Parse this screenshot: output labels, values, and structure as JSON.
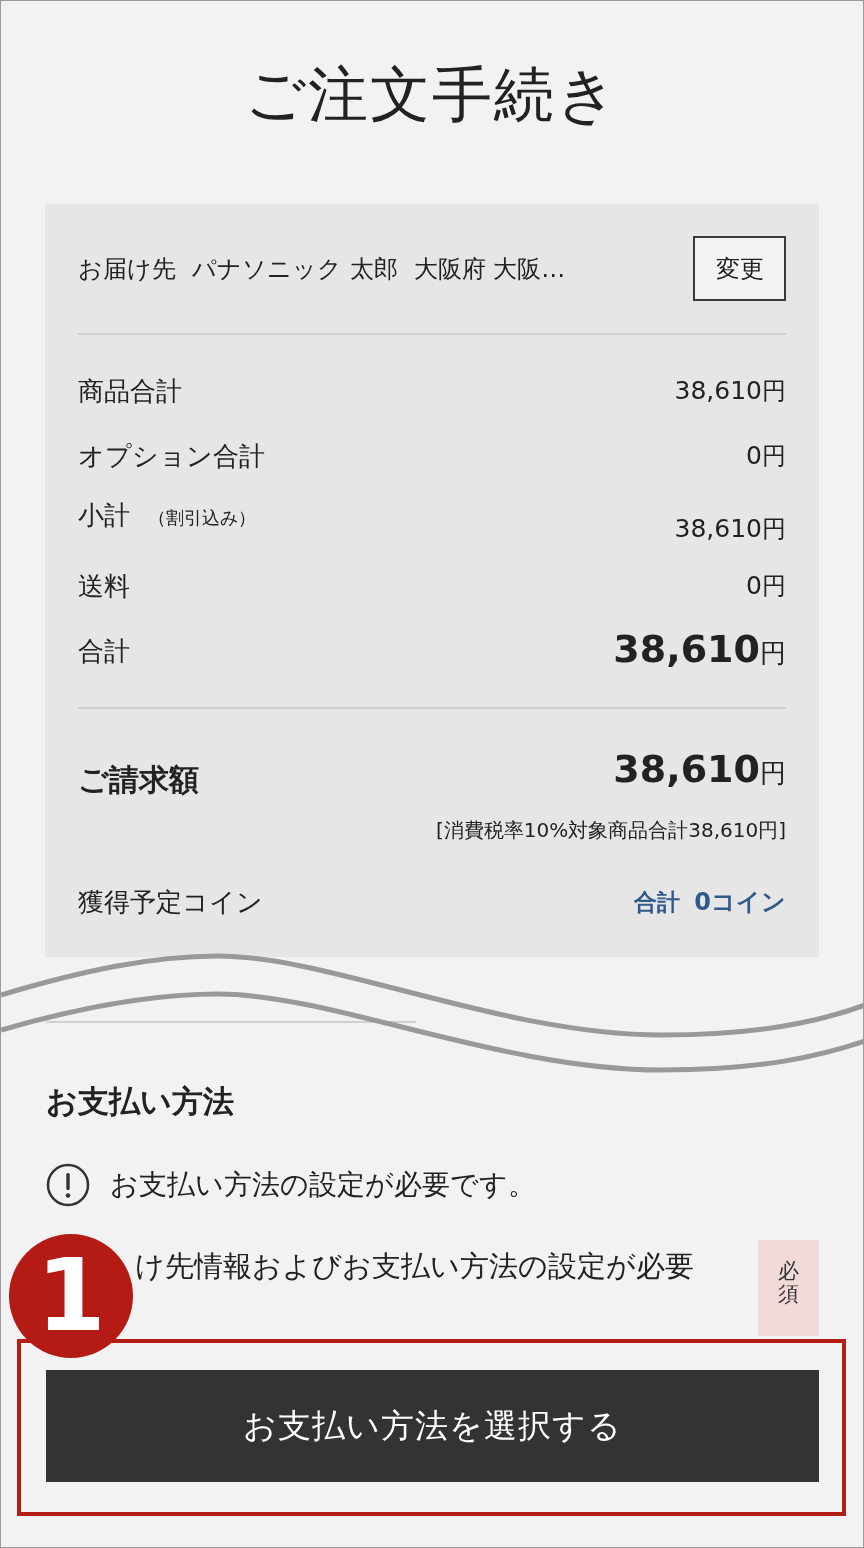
{
  "header": {
    "title": "ご注文手続き"
  },
  "summary": {
    "delivery": {
      "label": "お届け先",
      "recipient": "パナソニック 太郎",
      "address": "大阪府 大阪…",
      "change_button": "変更"
    },
    "rows": [
      {
        "kind": "regular",
        "label": "商品合計",
        "amount": "38,610",
        "unit": "円"
      },
      {
        "kind": "regular",
        "label": "オプション合計",
        "amount": "0",
        "unit": "円"
      },
      {
        "kind": "regular",
        "label": "小計",
        "note": "（割引込み）",
        "amount": "38,610",
        "unit": "円"
      },
      {
        "kind": "regular",
        "label": "送料",
        "amount": "0",
        "unit": "円"
      },
      {
        "kind": "emphasis",
        "label": "合計",
        "amount": "38,610",
        "unit": "円"
      }
    ],
    "billing": {
      "label": "ご請求額",
      "amount": "38,610",
      "unit": "円",
      "tax_note": "[消費税率10%対象商品合計38,610円]"
    },
    "coins": {
      "label": "獲得予定コイン",
      "total_label": "合計",
      "total": "0コイン"
    }
  },
  "payment": {
    "heading": "お支払い方法",
    "alert": "お支払い方法の設定が必要です。",
    "notice": "け先情報およびお支払い方法の設定が必要",
    "required_tag": "必須",
    "select_button": "お支払い方法を選択する"
  },
  "annotation": {
    "step_badge": "1",
    "highlighted": true
  }
}
